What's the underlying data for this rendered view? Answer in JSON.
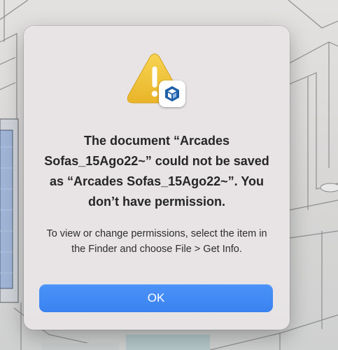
{
  "dialog": {
    "title": "The document “Arcades Sofas_15Ago22~” could not be saved as “Arcades Sofas_15Ago22~”. You don’t have permission.",
    "message": "To view or change permissions, select the item in the Finder and choose File > Get Info.",
    "ok_label": "OK",
    "icon": "warning-icon",
    "app_badge": "sketchup-app-icon"
  },
  "colors": {
    "button_accent": "#3a82f0",
    "warning_yellow": "#f0c333",
    "sketchup_blue": "#1e5fa8"
  }
}
